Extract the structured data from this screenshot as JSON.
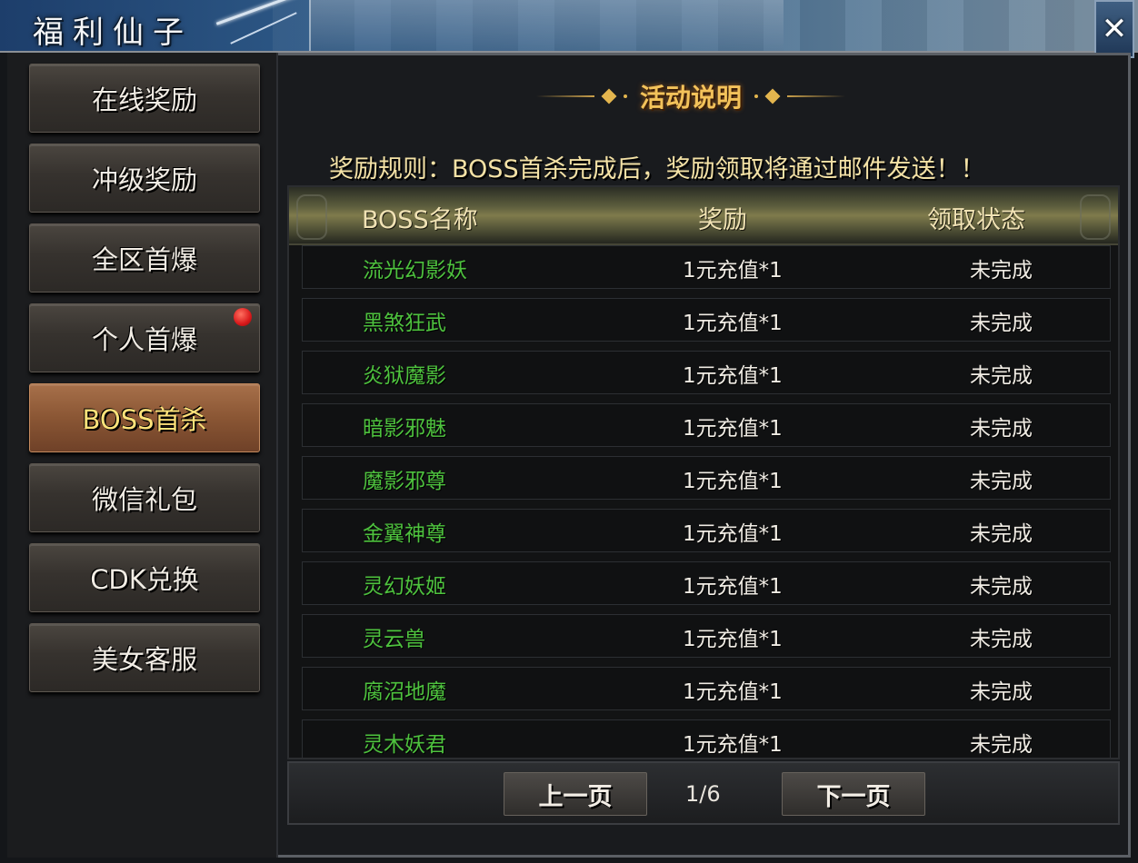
{
  "window": {
    "title": "福利仙子",
    "close_label": "✕"
  },
  "sidebar": {
    "items": [
      {
        "label": "在线奖励",
        "active": false,
        "badge": false
      },
      {
        "label": "冲级奖励",
        "active": false,
        "badge": false
      },
      {
        "label": "全区首爆",
        "active": false,
        "badge": false
      },
      {
        "label": "个人首爆",
        "active": false,
        "badge": true
      },
      {
        "label": "BOSS首杀",
        "active": true,
        "badge": false
      },
      {
        "label": "微信礼包",
        "active": false,
        "badge": false
      },
      {
        "label": "CDK兑换",
        "active": false,
        "badge": false
      },
      {
        "label": "美女客服",
        "active": false,
        "badge": false
      }
    ]
  },
  "panel": {
    "heading": "活动说明",
    "rule_text": "奖励规则：BOSS首杀完成后，奖励领取将通过邮件发送！！",
    "columns": [
      "BOSS名称",
      "奖励",
      "领取状态"
    ],
    "rows": [
      {
        "name": "流光幻影妖",
        "reward": "1元充值*1",
        "status": "未完成"
      },
      {
        "name": "黑煞狂武",
        "reward": "1元充值*1",
        "status": "未完成"
      },
      {
        "name": "炎狱魔影",
        "reward": "1元充值*1",
        "status": "未完成"
      },
      {
        "name": "暗影邪魅",
        "reward": "1元充值*1",
        "status": "未完成"
      },
      {
        "name": "魔影邪尊",
        "reward": "1元充值*1",
        "status": "未完成"
      },
      {
        "name": "金翼神尊",
        "reward": "1元充值*1",
        "status": "未完成"
      },
      {
        "name": "灵幻妖姬",
        "reward": "1元充值*1",
        "status": "未完成"
      },
      {
        "name": "灵云兽",
        "reward": "1元充值*1",
        "status": "未完成"
      },
      {
        "name": "腐沼地魔",
        "reward": "1元充值*1",
        "status": "未完成"
      },
      {
        "name": "灵木妖君",
        "reward": "1元充值*1",
        "status": "未完成"
      }
    ]
  },
  "pager": {
    "prev_label": "上一页",
    "next_label": "下一页",
    "page_text": "1/6"
  },
  "colors": {
    "boss_name": "#4ec23e",
    "heading": "#f3c25a",
    "active_tab": "#ffe37a",
    "badge": "#d9191b"
  }
}
